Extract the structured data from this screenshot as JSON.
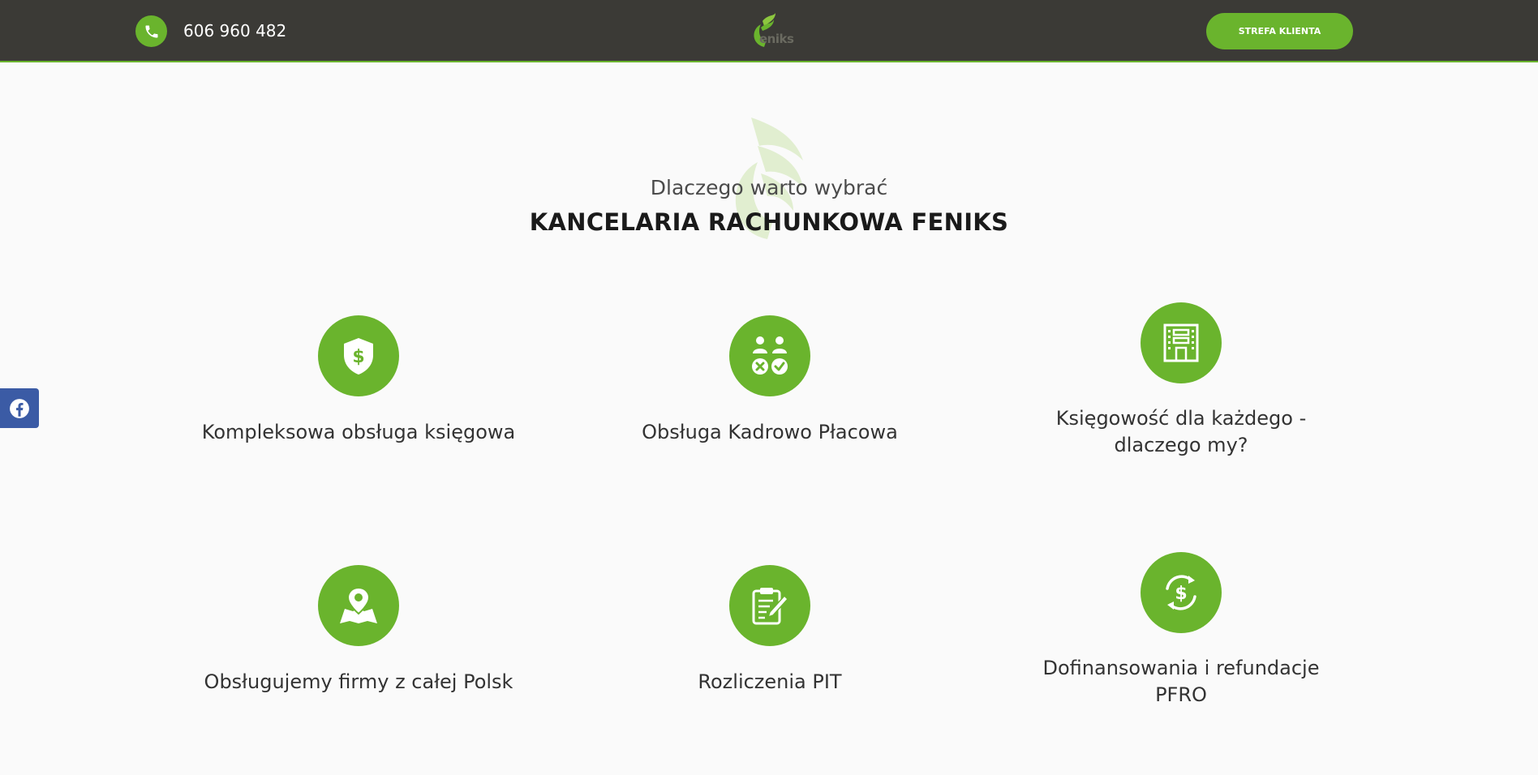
{
  "header": {
    "phone_number": "606 960 482",
    "logo_text": "eniks",
    "cta_label": "STREFA KLIENTA"
  },
  "intro": {
    "subtitle": "Dlaczego warto wybrać",
    "title": "KANCELARIA RACHUNKOWA FENIKS"
  },
  "features": [
    {
      "icon": "shield-dollar-icon",
      "label": "Kompleksowa obsługa księgowa"
    },
    {
      "icon": "people-approval-icon",
      "label": "Obsługa Kadrowo Płacowa"
    },
    {
      "icon": "office-building-icon",
      "label_line1": "Księgowość dla każdego -",
      "label_line2": "dlaczego my?"
    },
    {
      "icon": "map-pin-icon",
      "label": "Obsługujemy firmy z całej Polsk"
    },
    {
      "icon": "document-edit-icon",
      "label": "Rozliczenia PIT"
    },
    {
      "icon": "dollar-cycle-icon",
      "label_line1": "Dofinansowania i refundacje",
      "label_line2": "PFRO"
    }
  ],
  "social": {
    "icon": "facebook-icon"
  },
  "colors": {
    "accent": "#6ab42d",
    "header_bg": "#3b3a36",
    "page_bg": "#fafafa",
    "facebook": "#3b5ba5"
  }
}
